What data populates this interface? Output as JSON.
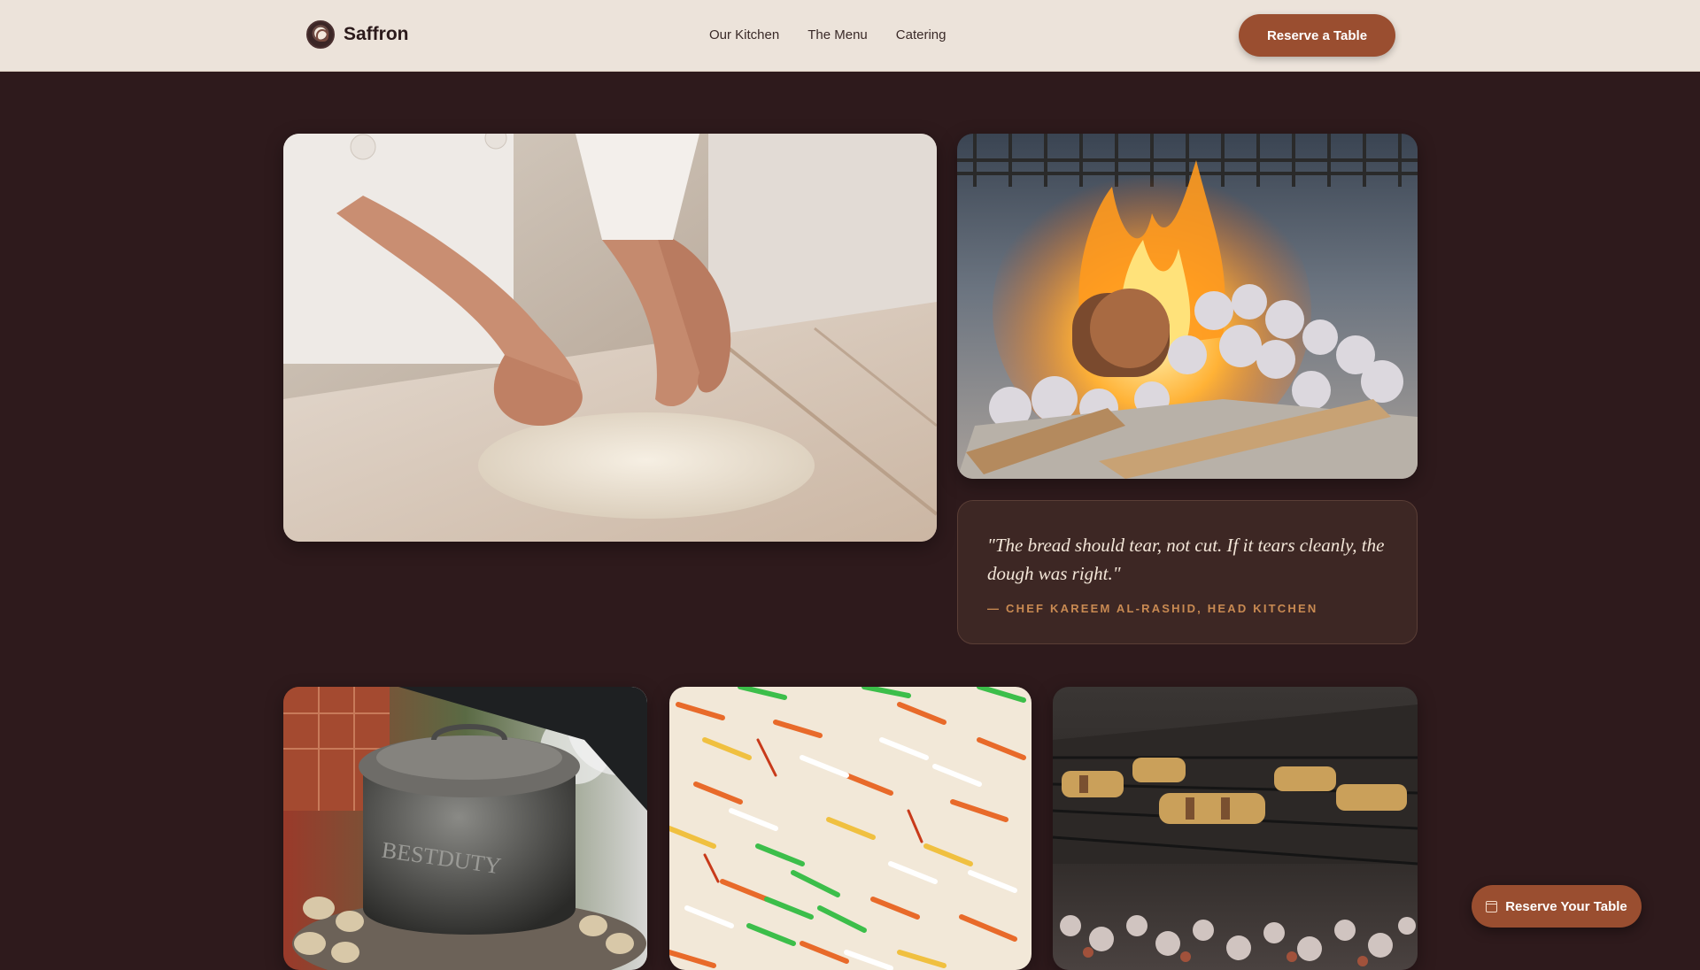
{
  "brand": {
    "name": "Saffron",
    "logo_icon": "saffron-logo-icon"
  },
  "nav": {
    "items": [
      {
        "label": "Our Kitchen"
      },
      {
        "label": "The Menu"
      },
      {
        "label": "Catering"
      }
    ]
  },
  "header": {
    "reserve_label": "Reserve a Table"
  },
  "gallery": {
    "photos": [
      {
        "subject": "chef kneading dough"
      },
      {
        "subject": "wood fire on coals"
      },
      {
        "subject": "cast iron pot on charcoal"
      },
      {
        "subject": "saffron rice"
      },
      {
        "subject": "skewers on grill"
      }
    ]
  },
  "quote": {
    "text": "\"The bread should tear, not cut. If it tears cleanly, the dough was right.\"",
    "author": "— CHEF KAREEM AL-RASHID, HEAD KITCHEN"
  },
  "floating_cta": {
    "label": "Reserve Your Table",
    "icon": "calendar-icon"
  },
  "colors": {
    "background": "#2e1a1c",
    "header": "#ece3da",
    "accent": "#9a4e30",
    "quote_author": "#c98a52"
  }
}
